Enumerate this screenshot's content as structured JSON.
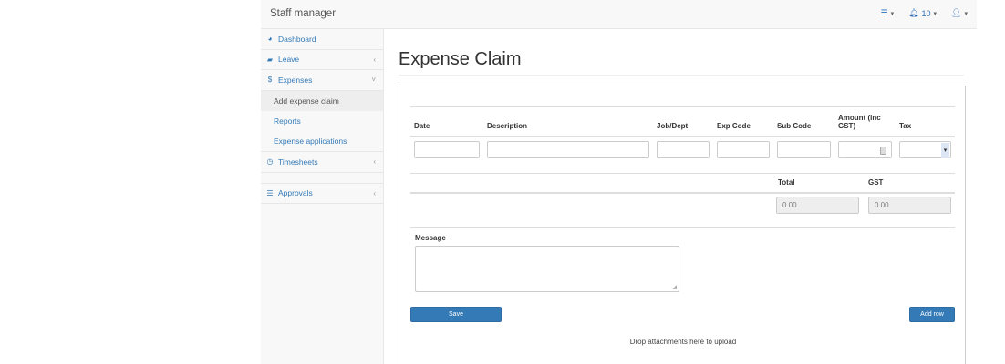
{
  "navbar": {
    "brand": "Staff manager",
    "notifications_count": "10"
  },
  "sidebar": {
    "items": [
      {
        "label": "Dashboard",
        "icon": "dashboard-icon"
      },
      {
        "label": "Leave",
        "icon": "briefcase-icon",
        "chevron": "‹"
      },
      {
        "label": "Expenses",
        "icon": "dollar-icon",
        "chevron": "˅"
      },
      {
        "label": "Timesheets",
        "icon": "clock-icon",
        "chevron": "‹"
      },
      {
        "label": "Approvals",
        "icon": "list-icon",
        "chevron": "‹"
      }
    ],
    "sub_items": [
      "Add expense claim",
      "Reports",
      "Expense applications"
    ]
  },
  "page": {
    "title": "Expense Claim"
  },
  "table": {
    "headers": [
      "Date",
      "Description",
      "Job/Dept",
      "Exp Code",
      "Sub Code",
      "Amount (inc GST)",
      "Tax"
    ]
  },
  "totals": {
    "total_label": "Total",
    "gst_label": "GST",
    "total_value": "0.00",
    "gst_value": "0.00"
  },
  "message": {
    "label": "Message"
  },
  "buttons": {
    "save": "Save",
    "add_row": "Add row"
  },
  "drop_text": "Drop attachments here to upload",
  "colors": {
    "primary": "#337ab7",
    "link": "#337ab7"
  }
}
